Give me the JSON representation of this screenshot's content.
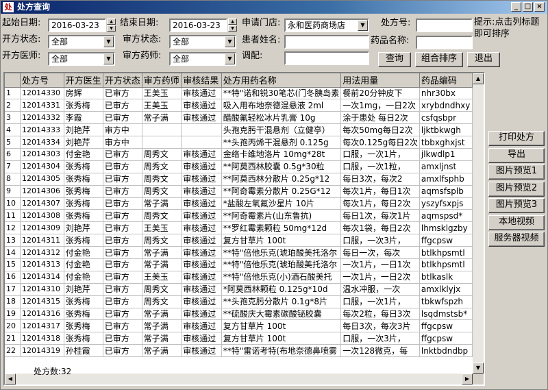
{
  "window": {
    "title": "处方查询",
    "icon_text": "处"
  },
  "filters": {
    "start_date_label": "起始日期:",
    "start_date_value": "2016-03-23",
    "end_date_label": "结束日期:",
    "end_date_value": "2016-03-23",
    "store_label": "申请门店:",
    "store_value": "永和医药商场店",
    "rx_no_label": "处方号:",
    "rx_no_value": "",
    "rx_status_label": "开方状态:",
    "rx_status_value": "全部",
    "review_status_label": "审方状态:",
    "review_status_value": "全部",
    "patient_label": "患者姓名:",
    "patient_value": "",
    "drug_name_label": "药品名称:",
    "drug_name_value": "",
    "doctor_label": "开方医师:",
    "doctor_value": "全部",
    "pharmacist_label": "审方药师:",
    "pharmacist_value": "全部",
    "dispense_label": "调配:",
    "dispense_value": ""
  },
  "hint": "提示:点击列标题即可排序",
  "buttons": {
    "query": "查询",
    "sort": "组合排序",
    "exit": "退出"
  },
  "side_buttons": [
    "打印处方",
    "导出",
    "图片预览1",
    "图片预览2",
    "图片预览3",
    "本地视频",
    "服务器视频"
  ],
  "table": {
    "headers": [
      "",
      "处方号",
      "开方医生",
      "开方状态",
      "审方药师",
      "审核结果",
      "处方用药名称",
      "用法用量",
      "药品编码"
    ],
    "rows": [
      [
        "1",
        "12014330",
        "房辉",
        "已审方",
        "王美玉",
        "审核通过",
        "**特\"诺和锐30笔芯(门冬胰岛素",
        "餐前20分钟皮下",
        "nhr30bx"
      ],
      [
        "2",
        "12014331",
        "张秀梅",
        "已审方",
        "王美玉",
        "审核通过",
        "吸入用布地奈德混悬液 2ml",
        "一次1mg，一日2次",
        "xrybdndhxy"
      ],
      [
        "3",
        "12014332",
        "李霞",
        "已审方",
        "常子满",
        "审核通过",
        "醋酸氟轻松冰片乳膏 10g",
        "涂于患处 每日2次",
        "csfqsbpr"
      ],
      [
        "4",
        "12014333",
        "刘艳芹",
        "审方中",
        "",
        "",
        "头孢克肟干混悬剂（立健亭）",
        "每次50mg每日2次",
        "ljktbkwgh"
      ],
      [
        "5",
        "12014334",
        "刘艳芹",
        "审方中",
        "",
        "",
        "**头孢丙烯干混悬剂 0.125g",
        "每次0.125g每日2次",
        "tbbxghxjst"
      ],
      [
        "6",
        "12014303",
        "付金艳",
        "已审方",
        "周秀文",
        "审核通过",
        "金络卡维地洛片 10mg*28t",
        "口服，一次1片，",
        "jlkwdlp1"
      ],
      [
        "7",
        "12014304",
        "张秀梅",
        "已审方",
        "周秀文",
        "审核通过",
        "**阿莫西林胶囊 0.5g*30粒",
        "口服，一次1粒，",
        "amxljnst"
      ],
      [
        "8",
        "12014305",
        "张秀梅",
        "已审方",
        "周秀文",
        "审核通过",
        "**阿莫西林分散片 0.25g*12",
        "每日3次，每次2",
        "amxlfsphb"
      ],
      [
        "9",
        "12014306",
        "张秀梅",
        "已审方",
        "周秀文",
        "审核通过",
        "**阿奇霉素分散片 0.25G*12",
        "每次1片，每日1次",
        "aqmsfsplb"
      ],
      [
        "10",
        "12014307",
        "张秀梅",
        "已审方",
        "常子满",
        "审核通过",
        "*盐酸左氧氟沙星片 10片",
        "每次1片，每日2次",
        "yszyfsxpjs"
      ],
      [
        "11",
        "12014308",
        "张秀梅",
        "已审方",
        "周秀文",
        "审核通过",
        "**阿奇霉素片(山东鲁抗)",
        "每日1次，每次1片",
        "aqmspsd*"
      ],
      [
        "12",
        "12014309",
        "刘艳芹",
        "已审方",
        "王美玉",
        "审核通过",
        "**罗红霉素颗粒 50mg*12d",
        "每次1袋，每日2次",
        "lhmsklgzby"
      ],
      [
        "13",
        "12014311",
        "张秀梅",
        "已审方",
        "周秀文",
        "审核通过",
        "复方甘草片 100t",
        "口服，一次3片，",
        "ffgcpsw"
      ],
      [
        "14",
        "12014312",
        "付金艳",
        "已审方",
        "常子满",
        "审核通过",
        "**特\"倍他乐克(琥珀酸美托洛尔",
        "每日一次，每次",
        "btlkhpsmtl"
      ],
      [
        "15",
        "12014313",
        "付金艳",
        "已审方",
        "常子满",
        "审核通过",
        "**特\"倍他乐克(琥珀酸美托洛尔",
        "一次1片，一日1次",
        "btlkhpsmtl"
      ],
      [
        "16",
        "12014314",
        "付金艳",
        "已审方",
        "王美玉",
        "审核通过",
        "**特\"倍他乐克(小)酒石酸美托",
        "一次1片，一日2次",
        "btlkaslk"
      ],
      [
        "17",
        "12014310",
        "刘艳芹",
        "已审方",
        "周秀文",
        "审核通过",
        "*阿莫西林颗粒 0.125g*10d",
        "温水冲服，一次",
        "amxlklyjx"
      ],
      [
        "18",
        "12014315",
        "张秀梅",
        "已审方",
        "周秀文",
        "审核通过",
        "**头孢克肟分散片 0.1g*8片",
        "口服，一次1片，",
        "tbkwfspzh"
      ],
      [
        "19",
        "12014316",
        "张秀梅",
        "已审方",
        "常子满",
        "审核通过",
        "**硫酸庆大霉素碳酸铋胶囊",
        "每次2粒，每日3次",
        "lsqdmstsb*"
      ],
      [
        "20",
        "12014317",
        "张秀梅",
        "已审方",
        "常子满",
        "审核通过",
        "复方甘草片 100t",
        "每日3次，每次3片",
        "ffgcpsw"
      ],
      [
        "21",
        "12014318",
        "张秀梅",
        "已审方",
        "常子满",
        "审核通过",
        "复方甘草片 100t",
        "口服，一次3片，",
        "ffgcpsw"
      ],
      [
        "22",
        "12014319",
        "孙桂霞",
        "已审方",
        "常子满",
        "审核通过",
        "**特\"雷诺考特(布地奈德鼻喷雾",
        "一次128微克，每",
        "lnktbdndbp"
      ]
    ]
  },
  "footer": {
    "count_text": "处方数:32"
  },
  "icons": {
    "spin_up": "▲",
    "spin_down": "▼",
    "combo": "▼",
    "scroll_up": "▲",
    "scroll_down": "▼",
    "scroll_left": "◀",
    "scroll_right": "▶"
  }
}
